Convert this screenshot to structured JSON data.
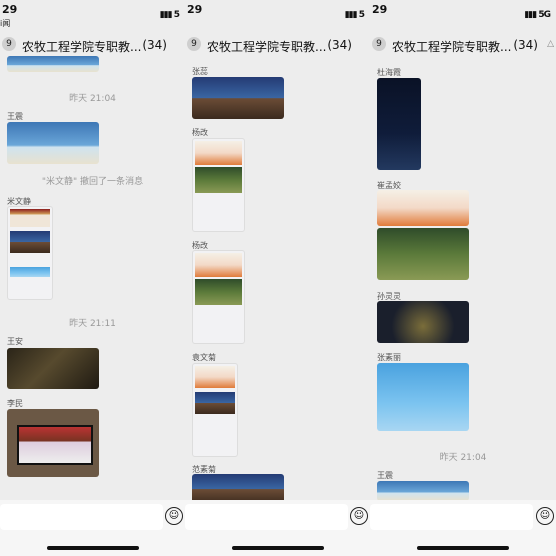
{
  "status": {
    "time": "29",
    "time_sub": "i闻",
    "signal": "5G"
  },
  "chat": {
    "back_badge": "9",
    "title": "农牧工程学院专职教...",
    "member_count": "(34)"
  },
  "panel1": {
    "timestamps": [
      "昨天 21:04",
      "昨天 21:11"
    ],
    "recall_notice": "\"米文静\" 撤回了一条消息",
    "senders": [
      "王震",
      "米文静",
      "王安",
      "李民"
    ]
  },
  "panel2": {
    "senders": [
      "张蕊",
      "杨改",
      "杨改",
      "袁文菊",
      "范素菊"
    ]
  },
  "panel3": {
    "senders": [
      "杜海霞",
      "崔孟姣",
      "孙灵灵",
      "张素丽",
      "王震"
    ],
    "timestamps": [
      "昨天 21:04"
    ]
  },
  "icons": {
    "emoji": "☺",
    "mute": "🔕"
  }
}
